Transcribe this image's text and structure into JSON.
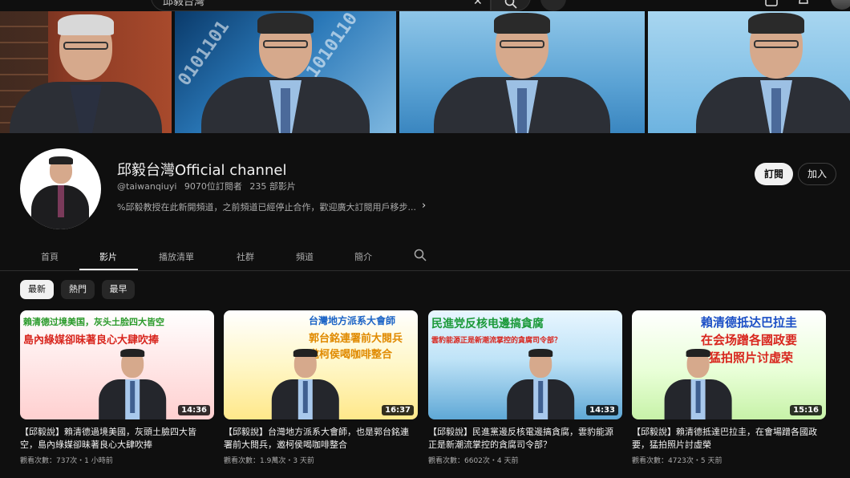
{
  "topbar": {
    "search_text": "邱毅台灣",
    "clear_icon": "close-icon",
    "search_icon": "search-icon",
    "mic_icon": "mic-icon"
  },
  "channel": {
    "name": "邱毅台灣Official channel",
    "handle": "@taiwanqiuyi",
    "subscribers": "9070位訂閱者",
    "video_count": "235 部影片",
    "description": "%邱毅教授在此新開頻道，之前頻道已經停止合作，歡迎廣大訂閱用戶移步...",
    "subscribe_label": "訂閱",
    "join_label": "加入"
  },
  "tabs": [
    {
      "label": "首頁",
      "active": false
    },
    {
      "label": "影片",
      "active": true
    },
    {
      "label": "播放清單",
      "active": false
    },
    {
      "label": "社群",
      "active": false
    },
    {
      "label": "頻道",
      "active": false
    },
    {
      "label": "簡介",
      "active": false
    }
  ],
  "chips": [
    {
      "label": "最新",
      "selected": true
    },
    {
      "label": "熱門",
      "selected": false
    },
    {
      "label": "最早",
      "selected": false
    }
  ],
  "videos": [
    {
      "thumb_line1": "賴清德过境美国，灰头土脸四大皆空",
      "thumb_line2": "島內綠媒卻昧著良心大肆吹捧",
      "duration": "14:36",
      "title": "【邱毅說】賴清德過境美國，灰頭土臉四大皆空，島內綠媒卻昧著良心大肆吹捧",
      "meta": "觀看次數：737次・1 小時前"
    },
    {
      "thumb_line1": "台灣地方派系大會師",
      "thumb_line2": "郭台銘連署前大閱兵",
      "thumb_line3": "邀柯侯喝咖啡整合",
      "duration": "16:37",
      "title": "【邱毅說】台灣地方派系大會師，也是郭台銘連署前大閱兵，邀柯侯喝咖啡整合",
      "meta": "觀看次數：1.9萬次・3 天前"
    },
    {
      "thumb_line1": "民進党反核电邊搞貪腐",
      "thumb_line2": "雲豹能源正是新潮流掌控的貪腐司令部？",
      "duration": "14:33",
      "title": "【邱毅說】民進黨邊反核電邊搞貪腐，雲豹能源正是新潮流掌控的貪腐司令部？",
      "meta": "觀看次數：6602次・4 天前"
    },
    {
      "thumb_line1": "賴清德抵达巴拉圭",
      "thumb_line2": "在会场蹭各國政要",
      "thumb_line3": "猛拍照片讨虚荣",
      "duration": "15:16",
      "title": "【邱毅說】賴清德抵達巴拉圭，在會場蹭各國政要，猛拍照片討虛榮",
      "meta": "觀看次數：4723次・5 天前"
    }
  ],
  "colors": {
    "background": "#0f0f0f",
    "text_primary": "#f1f1f1",
    "text_secondary": "#aaaaaa"
  }
}
